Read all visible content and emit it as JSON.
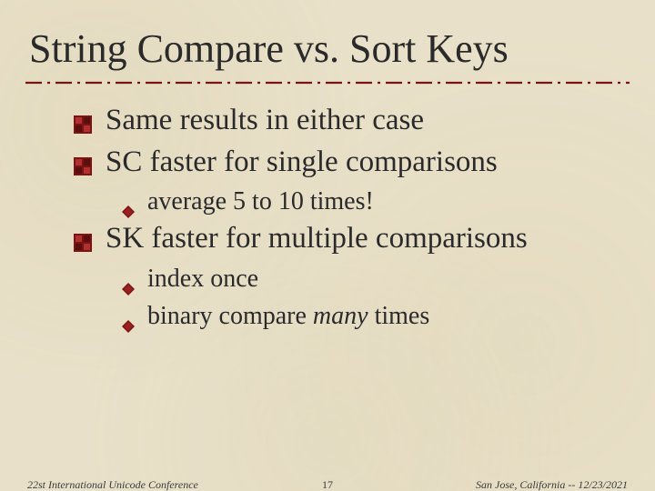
{
  "title": "String Compare vs. Sort Keys",
  "bullets": {
    "b1": "Same results in either case",
    "b2": "SC faster for single comparisons",
    "b2_sub1": "average 5 to 10 times!",
    "b3": "SK faster for multiple comparisons",
    "b3_sub1": "index once",
    "b3_sub2_pre": "binary compare ",
    "b3_sub2_em": "many",
    "b3_sub2_post": " times"
  },
  "footer": {
    "left": "22st International Unicode Conference",
    "center": "17",
    "right": "San Jose, California -- 12/23/2021"
  },
  "colors": {
    "accent": "#7a1414",
    "text": "#2a2a2a",
    "bg": "#e8e0c8"
  }
}
